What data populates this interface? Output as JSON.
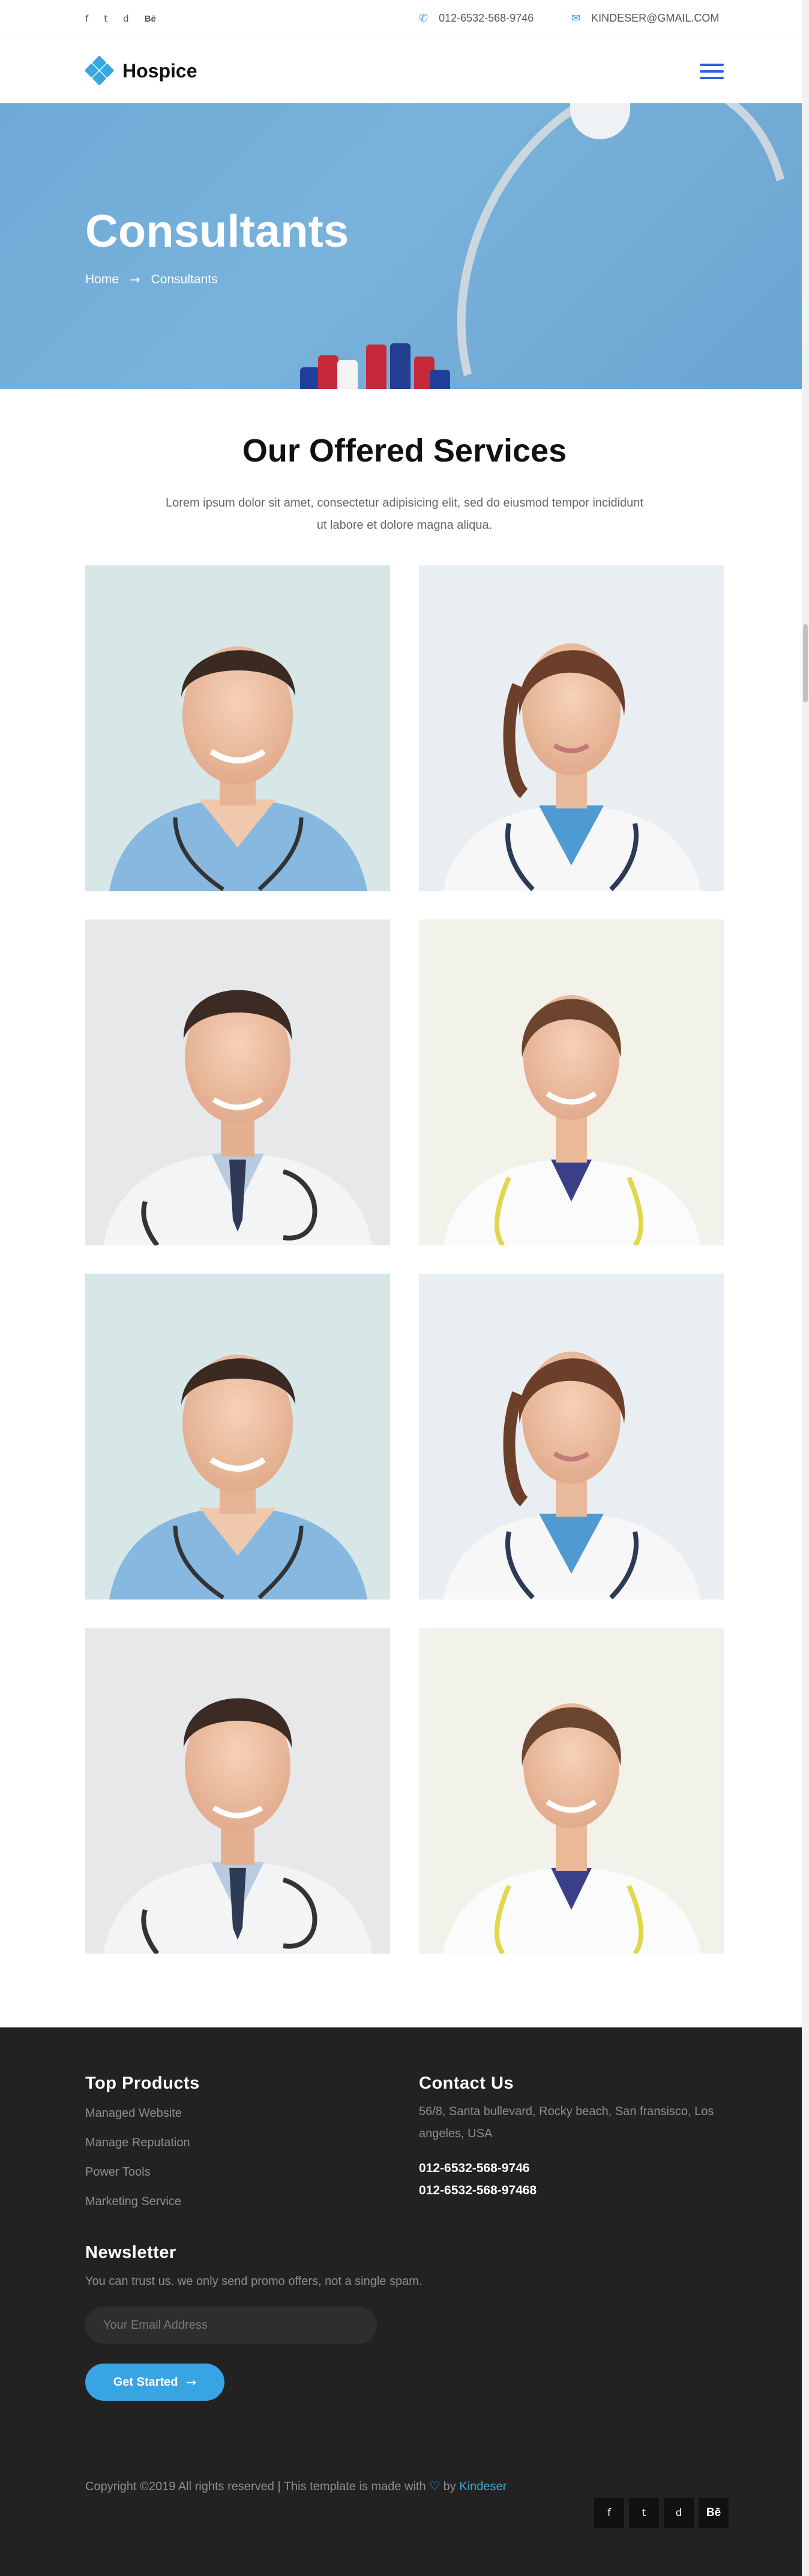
{
  "topbar": {
    "social": [
      "f",
      "t",
      "d",
      "Bē"
    ],
    "phone": "012-6532-568-9746",
    "email": "KINDESER@GMAIL.COM"
  },
  "header": {
    "logo_text": "Hospice"
  },
  "hero": {
    "title": "Consultants",
    "breadcrumb_home": "Home",
    "breadcrumb_arrow": "→",
    "breadcrumb_current": "Consultants"
  },
  "services": {
    "title": "Our Offered Services",
    "description": "Lorem ipsum dolor sit amet, consectetur adipisicing elit, sed do eiusmod tempor incididunt ut labore et dolore magna aliqua."
  },
  "footer": {
    "products_title": "Top Products",
    "products": [
      "Managed Website",
      "Manage Reputation",
      "Power Tools",
      "Marketing Service"
    ],
    "contact_title": "Contact Us",
    "address": "56/8, Santa bullevard, Rocky beach, San fransisco, Los angeles, USA",
    "phone_1": "012-6532-568-9746",
    "phone_2": "012-6532-568-97468",
    "newsletter_title": "Newsletter",
    "newsletter_text": "You can trust us. we only send promo offers, not a single spam.",
    "email_placeholder": "Your Email Address",
    "cta_label": "Get Started",
    "cta_arrow": "→",
    "copyright_prefix": "Copyright ©2019 All rights reserved | This template is made with",
    "copyright_heart": "♡",
    "copyright_by": "by",
    "copyright_brand": "Kindeser",
    "social": [
      "f",
      "t",
      "d",
      "Bē"
    ]
  }
}
